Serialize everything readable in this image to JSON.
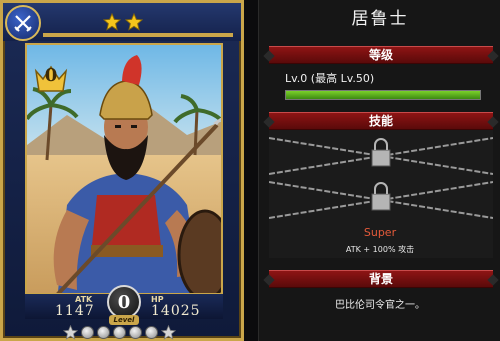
{
  "card": {
    "rarity_number": "0",
    "stats": {
      "atk_label": "ATK",
      "atk_value": "1147",
      "hp_label": "HP",
      "hp_value": "14025"
    },
    "level_value": "0",
    "level_label": "Level",
    "star_count": 2,
    "accent_color": "#caa64a"
  },
  "panel": {
    "hero_name": "居鲁士",
    "sections": {
      "grade": "等级",
      "skill": "技能",
      "background": "背景"
    },
    "level_text": "Lv.0 (最高 Lv.50)",
    "level_progress": 1.0,
    "skill_name": "Super",
    "skill_desc": "ATK + 100% 攻击",
    "background_text": "巴比伦司令官之一。",
    "header_color": "#8e1414",
    "progress_color": "#5fb81e",
    "skill_name_color": "#e55a3a"
  },
  "icons": {
    "class_badge": "crossed-swords-icon",
    "rarity_badge": "crown-icon",
    "skill_lock": "chain-lock-icon"
  }
}
